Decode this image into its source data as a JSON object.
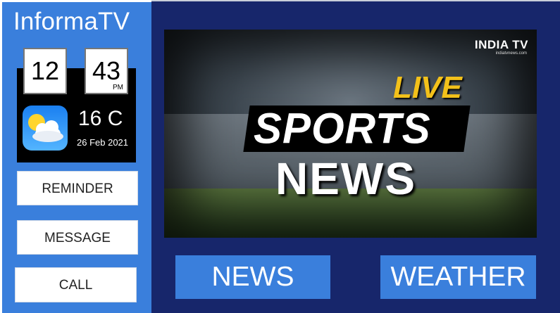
{
  "app": {
    "title": "InformaTV"
  },
  "clock": {
    "hours": "12",
    "minutes": "43",
    "ampm": "PM"
  },
  "weather": {
    "icon": "partly-cloudy-icon",
    "temperature": "16 C",
    "date": "26 Feb 2021"
  },
  "sidebar": {
    "buttons": [
      {
        "label": "REMINDER"
      },
      {
        "label": "MESSAGE"
      },
      {
        "label": "CALL"
      }
    ]
  },
  "video": {
    "logo": "INDIA TV",
    "logo_sub": "indiatvnews.com",
    "live": "LIVE",
    "sports": "SPORTS",
    "news": "NEWS"
  },
  "main": {
    "buttons": [
      {
        "label": "NEWS"
      },
      {
        "label": "WEATHER"
      }
    ]
  },
  "colors": {
    "sidebar": "#3a7fdc",
    "main_background": "#17266b",
    "button": "#3a7fdc",
    "live": "#f3c11a"
  }
}
